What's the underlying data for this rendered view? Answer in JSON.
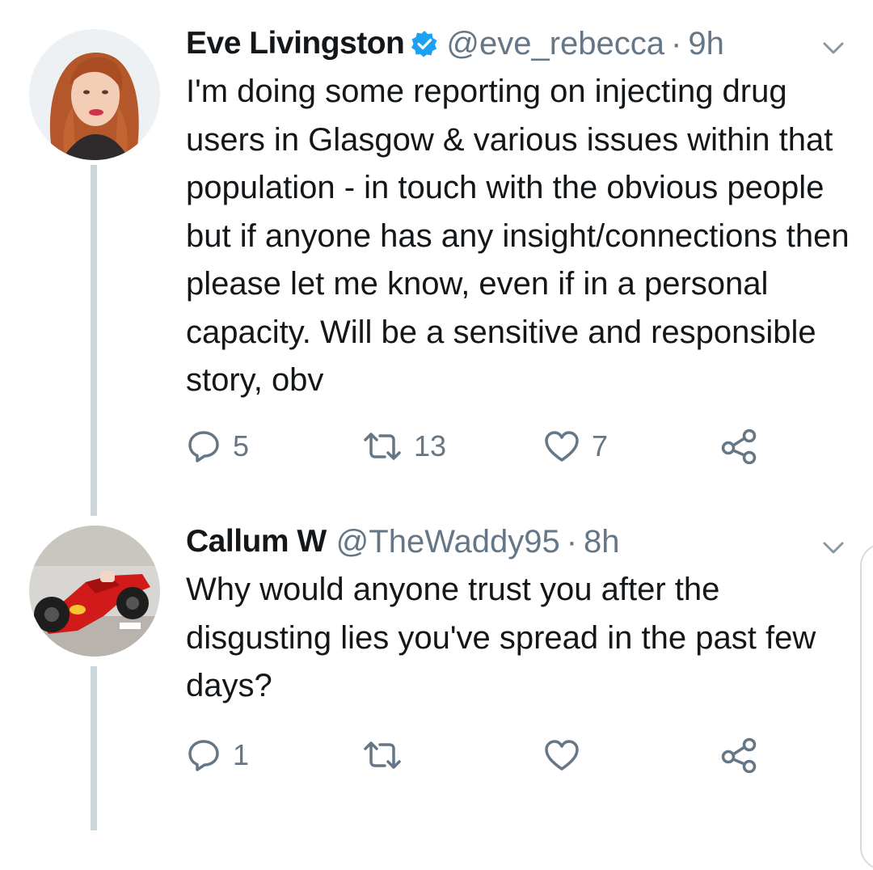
{
  "colors": {
    "text": "#14171a",
    "secondary": "#657786",
    "verified_badge": "#1da1f2",
    "thread_line": "#ccd6dd"
  },
  "tweets": [
    {
      "name": "Eve Livingston",
      "verified": true,
      "handle": "@eve_rebecca",
      "separator": "·",
      "time": "9h",
      "body": "I'm doing some reporting on injecting drug users in Glasgow & various issues within that population - in touch with the obvious people but if anyone has any insight/connections then please let me know, even if in a personal capacity. Will be a sensitive and responsible story, obv",
      "actions": {
        "reply_count": "5",
        "retweet_count": "13",
        "like_count": "7"
      },
      "icons": [
        "reply-icon",
        "retweet-icon",
        "like-icon",
        "share-icon",
        "chevron-down-icon"
      ]
    },
    {
      "name": "Callum W",
      "verified": false,
      "handle": "@TheWaddy95",
      "separator": "·",
      "time": "8h",
      "body": "Why would anyone trust you after the disgusting lies you've spread in the past few days?",
      "actions": {
        "reply_count": "1",
        "retweet_count": "",
        "like_count": ""
      },
      "icons": [
        "reply-icon",
        "retweet-icon",
        "like-icon",
        "share-icon",
        "chevron-down-icon"
      ]
    }
  ]
}
